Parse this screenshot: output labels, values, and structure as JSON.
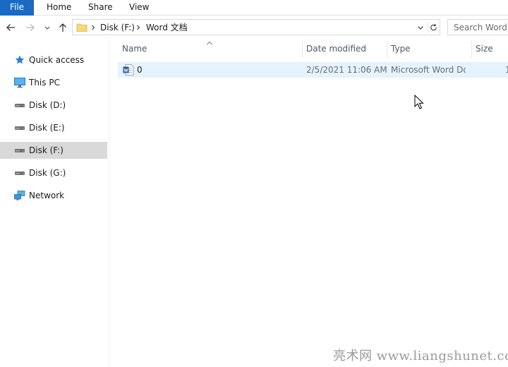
{
  "ribbon": {
    "tabs": [
      {
        "label": "File"
      },
      {
        "label": "Home"
      },
      {
        "label": "Share"
      },
      {
        "label": "View"
      }
    ]
  },
  "address": {
    "crumbs": [
      "Disk (F:)",
      "Word 文档"
    ]
  },
  "search": {
    "placeholder": "Search Word 文档"
  },
  "nav": {
    "items": [
      {
        "label": "Quick access",
        "icon": "star-icon"
      },
      {
        "label": "This PC",
        "icon": "monitor-icon"
      },
      {
        "label": "Disk (D:)",
        "icon": "drive-icon"
      },
      {
        "label": "Disk (E:)",
        "icon": "drive-icon"
      },
      {
        "label": "Disk (F:)",
        "icon": "drive-icon",
        "selected": true
      },
      {
        "label": "Disk (G:)",
        "icon": "drive-icon"
      },
      {
        "label": "Network",
        "icon": "network-icon"
      }
    ]
  },
  "columns": {
    "name": "Name",
    "date": "Date modified",
    "type": "Type",
    "size": "Size"
  },
  "files": [
    {
      "name": "0",
      "date": "2/5/2021 11:06 AM",
      "type": "Microsoft Word Document",
      "size": "1",
      "icon": "word-doc-icon"
    }
  ],
  "watermark": "亮术网 www.liangshunet.com",
  "colors": {
    "accent": "#1a69c2",
    "selection": "#e5f3ff",
    "nav_selected": "#d9d9d9"
  }
}
